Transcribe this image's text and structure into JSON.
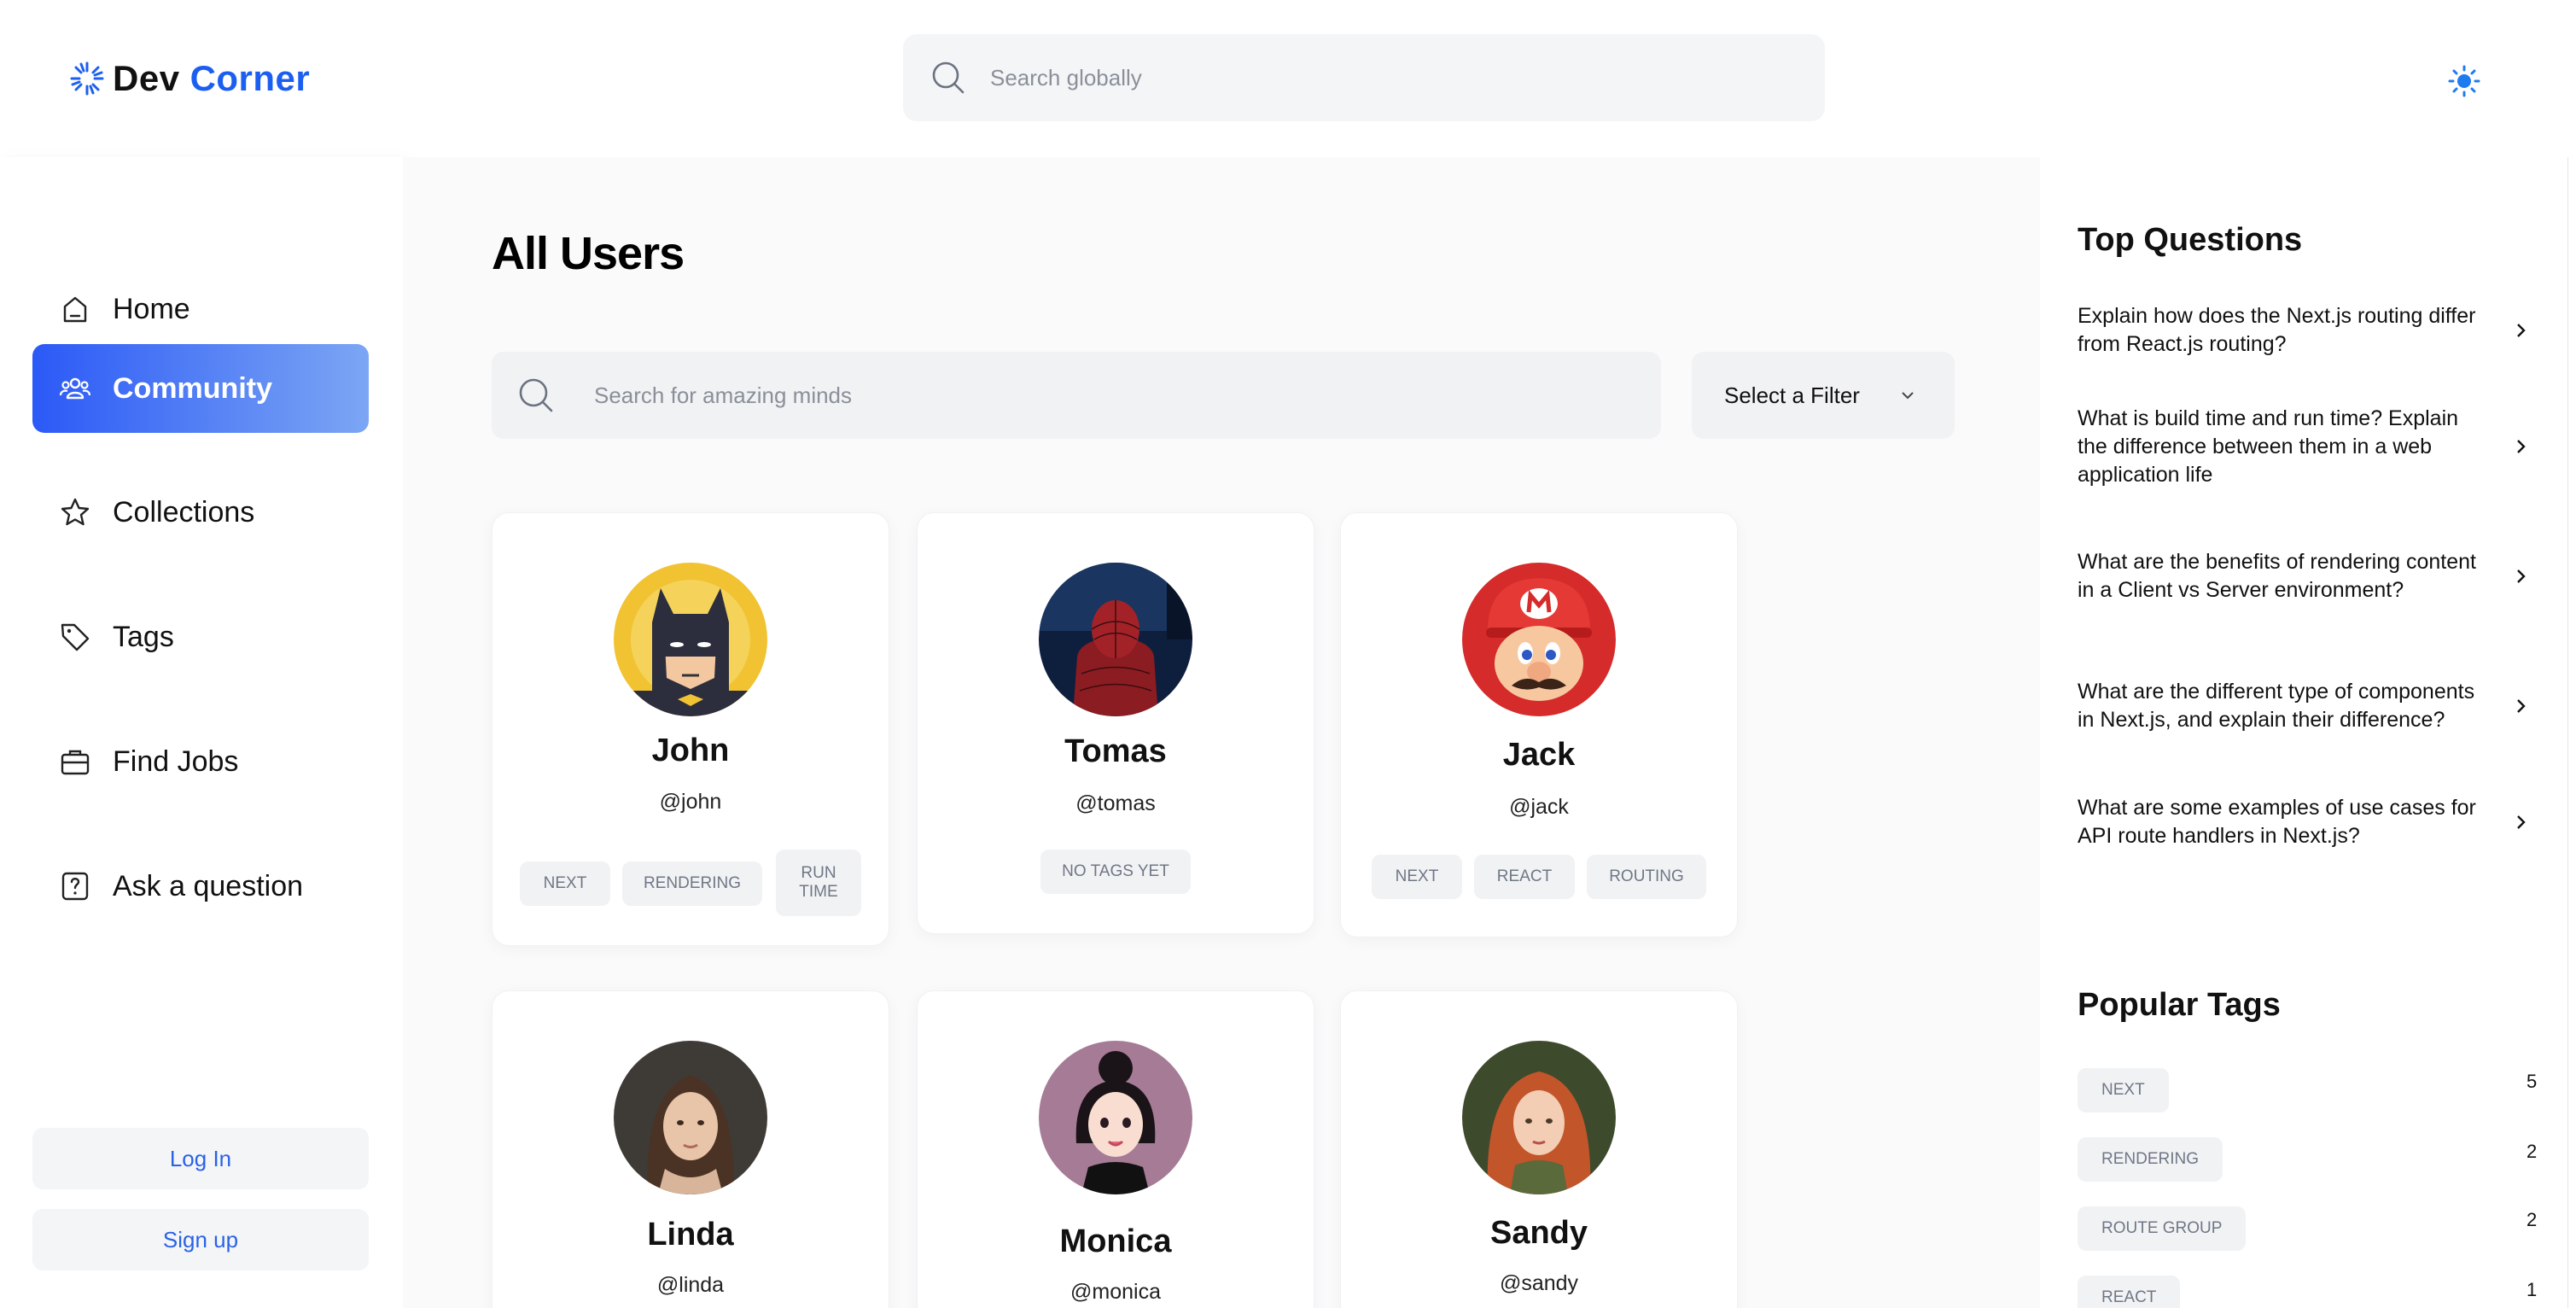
{
  "header": {
    "logo_dev": "Dev",
    "logo_corner": "Corner",
    "search_placeholder": "Search globally"
  },
  "sidebar": {
    "items": [
      {
        "label": "Home",
        "icon": "home-icon"
      },
      {
        "label": "Community",
        "icon": "users-icon",
        "active": true
      },
      {
        "label": "Collections",
        "icon": "star-icon"
      },
      {
        "label": "Tags",
        "icon": "tag-icon"
      },
      {
        "label": "Find Jobs",
        "icon": "briefcase-icon"
      },
      {
        "label": "Ask a question",
        "icon": "question-icon"
      }
    ],
    "login_label": "Log In",
    "signup_label": "Sign up"
  },
  "main": {
    "title": "All Users",
    "search_placeholder": "Search for amazing minds",
    "filter_label": "Select a Filter",
    "users": [
      {
        "name": "John",
        "handle": "@john",
        "tags": [
          "NEXT",
          "RENDERING",
          "RUN TIME"
        ]
      },
      {
        "name": "Tomas",
        "handle": "@tomas",
        "tags": [
          "NO TAGS YET"
        ]
      },
      {
        "name": "Jack",
        "handle": "@jack",
        "tags": [
          "NEXT",
          "REACT",
          "ROUTING"
        ]
      },
      {
        "name": "Linda",
        "handle": "@linda",
        "tags": []
      },
      {
        "name": "Monica",
        "handle": "@monica",
        "tags": []
      },
      {
        "name": "Sandy",
        "handle": "@sandy",
        "tags": []
      }
    ]
  },
  "right_sidebar": {
    "top_questions_title": "Top Questions",
    "questions": [
      "Explain how does the Next.js routing differ from React.js routing?",
      "What is build time and run time? Explain the difference between them in a web application life",
      "What are the benefits of rendering content in a Client vs Server environment?",
      "What are the different type of components in Next.js, and explain their difference?",
      "What are some examples of use cases for API route handlers in Next.js?"
    ],
    "popular_tags_title": "Popular Tags",
    "popular_tags": [
      {
        "name": "NEXT",
        "count": "5"
      },
      {
        "name": "RENDERING",
        "count": "2"
      },
      {
        "name": "ROUTE GROUP",
        "count": "2"
      },
      {
        "name": "REACT",
        "count": "1"
      }
    ]
  },
  "colors": {
    "accent": "#1c5ff0",
    "gradient_start": "#2b59f6",
    "gradient_end": "#7ca6f4",
    "tag_bg": "#f1f2f4",
    "tag_text": "#6f7786"
  }
}
